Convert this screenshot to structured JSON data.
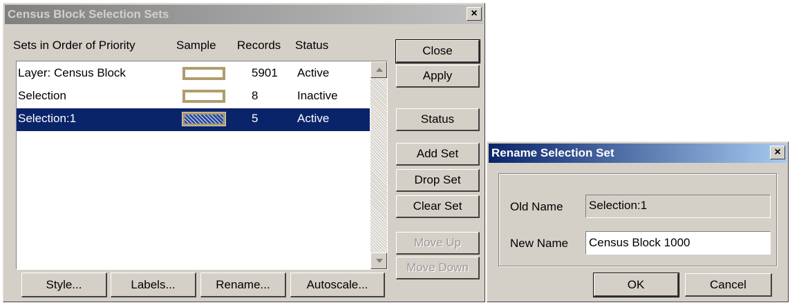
{
  "main_dialog": {
    "title": "Census Block Selection Sets",
    "close_glyph": "×",
    "columns": [
      "Sets in Order of Priority",
      "Sample",
      "Records",
      "Status"
    ],
    "rows": [
      {
        "name": "Layer: Census Block",
        "sample": "outline",
        "records": "5901",
        "status": "Active",
        "selected": false
      },
      {
        "name": "Selection",
        "sample": "outline",
        "records": "8",
        "status": "Inactive",
        "selected": false
      },
      {
        "name": "Selection:1",
        "sample": "pattern",
        "records": "5",
        "status": "Active",
        "selected": true
      }
    ],
    "side_buttons": {
      "close": "Close",
      "apply": "Apply",
      "status": "Status",
      "add_set": "Add Set",
      "drop_set": "Drop Set",
      "clear_set": "Clear Set",
      "move_up": "Move Up",
      "move_down": "Move Down"
    },
    "bottom_buttons": {
      "style": "Style...",
      "labels": "Labels...",
      "rename": "Rename...",
      "autoscale": "Autoscale..."
    }
  },
  "rename_dialog": {
    "title": "Rename Selection Set",
    "close_glyph": "×",
    "old_name_label": "Old Name",
    "old_name_value": "Selection:1",
    "new_name_label": "New Name",
    "new_name_value": "Census Block 1000",
    "ok": "OK",
    "cancel": "Cancel"
  },
  "colors": {
    "selection_highlight": "#0a246a",
    "active_title": "#0a246a",
    "inactive_title": "#808080",
    "sample_border": "#b09c6c"
  }
}
